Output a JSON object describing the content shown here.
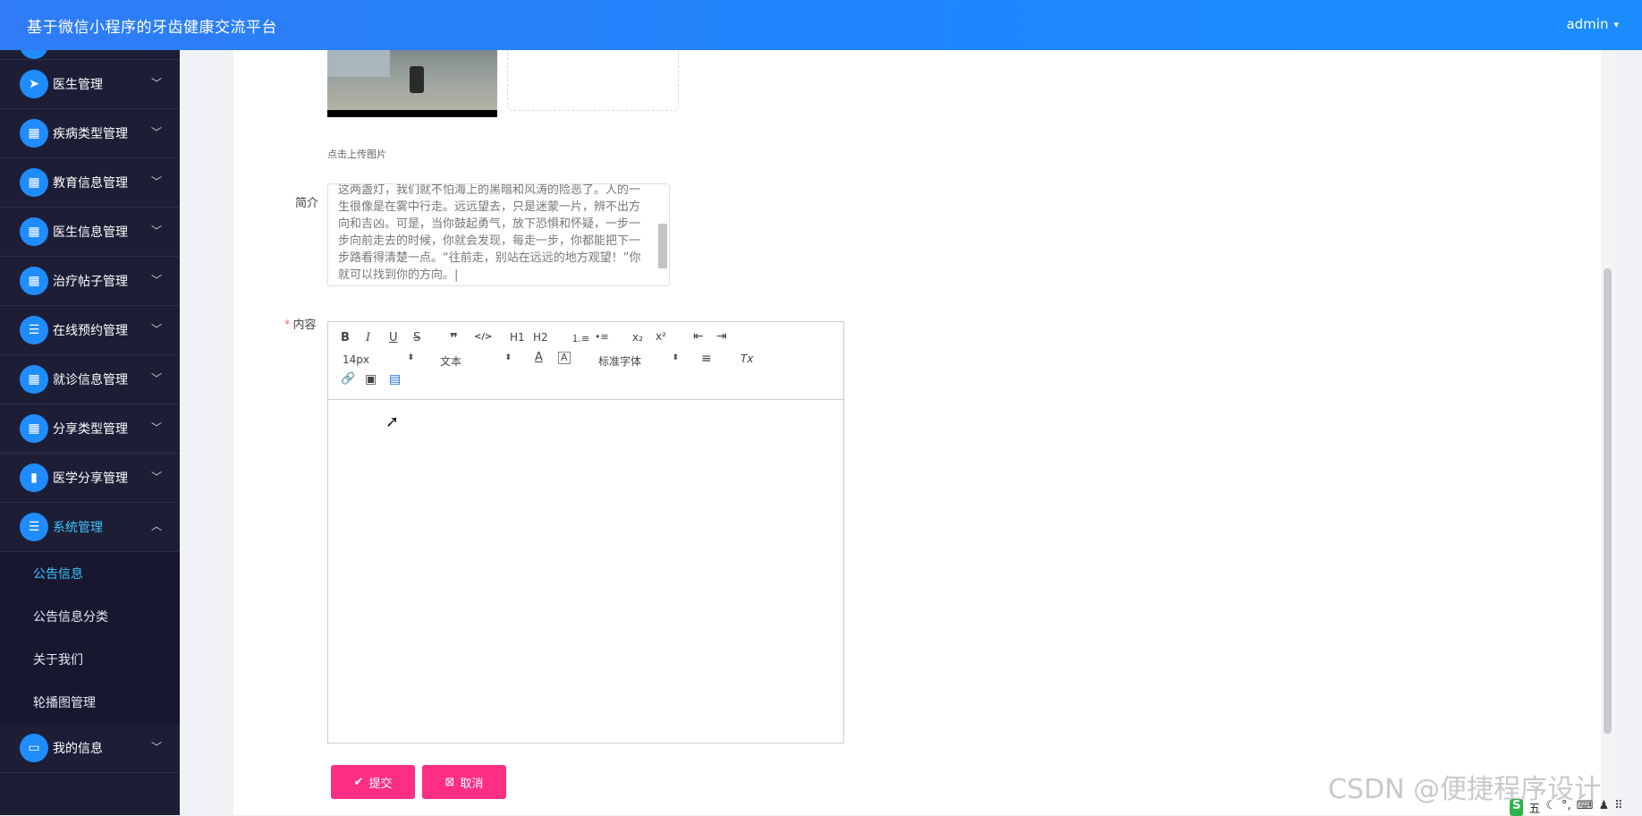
{
  "header": {
    "title": "基于微信小程序的牙齿健康交流平台",
    "user": "admin",
    "caret": "▾"
  },
  "sidebar": {
    "items": [
      {
        "label": "医生管理",
        "icon": "paper-plane-icon"
      },
      {
        "label": "疾病类型管理",
        "icon": "grid-icon"
      },
      {
        "label": "教育信息管理",
        "icon": "grid-icon"
      },
      {
        "label": "医生信息管理",
        "icon": "grid-icon"
      },
      {
        "label": "治疗帖子管理",
        "icon": "grid-icon"
      },
      {
        "label": "在线预约管理",
        "icon": "list-icon"
      },
      {
        "label": "就诊信息管理",
        "icon": "grid-icon"
      },
      {
        "label": "分享类型管理",
        "icon": "grid-icon"
      },
      {
        "label": "医学分享管理",
        "icon": "bar-chart-icon"
      },
      {
        "label": "系统管理",
        "icon": "list-icon",
        "active": true
      }
    ],
    "subitems": [
      {
        "label": "公告信息",
        "active": true
      },
      {
        "label": "公告信息分类"
      },
      {
        "label": "关于我们"
      },
      {
        "label": "轮播图管理"
      }
    ],
    "last_item": {
      "label": "我的信息",
      "icon": "window-icon"
    }
  },
  "form": {
    "upload_hint": "点击上传图片",
    "intro_label": "简介",
    "intro_text": "这两盏灯，我们就不怕海上的黑暗和风涛的险恶了。人的一生很像是在雾中行走。远远望去，只是迷蒙一片，辨不出方向和吉凶。可是，当你鼓起勇气，放下恐惧和怀疑，一步一步向前走去的时候，你就会发现，每走一步，你都能把下一步路看得清楚一点。“往前走，别站在远远的地方观望！”你就可以找到你的方向。|",
    "content_label": "内容",
    "required_mark": "*",
    "toolbar": {
      "bold": "B",
      "italic": "I",
      "underline": "U",
      "strike": "S",
      "quote": "❞",
      "code": "</>",
      "h1": "H1",
      "h2": "H2",
      "ordered_list": "⒈≡",
      "bullet_list": "•≡",
      "subscript": "x₂",
      "superscript": "x²",
      "outdent": "⇤",
      "indent": "⇥",
      "size": "14px",
      "header": "文本",
      "font": "标准字体",
      "align": "≡",
      "clean": "Tx",
      "link": "🔗",
      "image": "▣",
      "video": "▤"
    },
    "submit_label": "提交",
    "cancel_label": "取消"
  },
  "watermark": "CSDN @便捷程序设计",
  "tray": [
    "S",
    "五",
    "☾",
    "°,",
    "⌨",
    "♟",
    "⠿"
  ],
  "colors": {
    "topbar": "#1e87ff",
    "sidebar": "#1d1e36",
    "accent": "#3ec3ff",
    "button": "#ff2e85"
  }
}
